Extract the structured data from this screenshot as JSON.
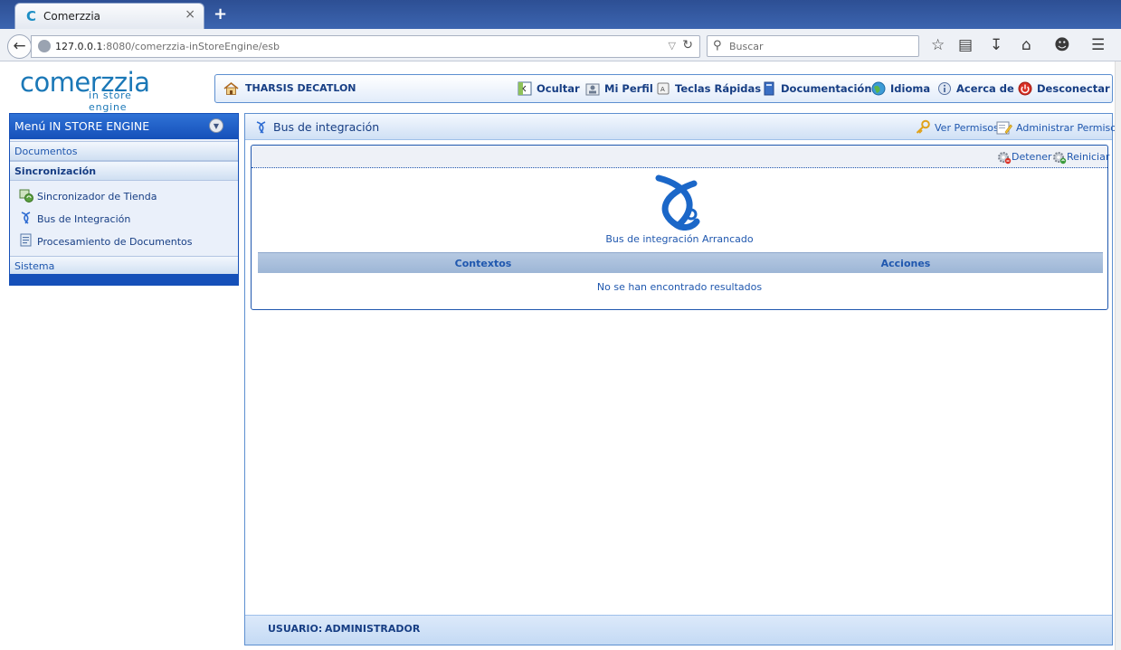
{
  "browser": {
    "tab_title": "Comerzzia",
    "tab_favicon": "C",
    "tab_close": "×",
    "new_tab": "+",
    "url_host": "127.0.0.1",
    "url_rest": ":8080/comerzzia-inStoreEngine/esb",
    "search_placeholder": "Buscar",
    "icons": [
      "back-arrow-icon",
      "globe-icon",
      "reload-icon",
      "search-icon",
      "bookmark-star-icon",
      "reading-list-icon",
      "download-icon",
      "home-icon",
      "chat-icon",
      "hamburger-menu-icon"
    ]
  },
  "logo": {
    "word": "comerzzia",
    "tagline": "in store engine"
  },
  "topbar": {
    "company": "THARSIS DECATLON",
    "menu": [
      {
        "label": "Ocultar",
        "icon": "hide-window-icon"
      },
      {
        "label": "Mi Perfil",
        "icon": "profile-icon"
      },
      {
        "label": "Teclas Rápidas",
        "icon": "keyboard-key-icon"
      },
      {
        "label": "Documentación",
        "icon": "book-icon"
      },
      {
        "label": "Idioma",
        "icon": "globe-icon"
      },
      {
        "label": "Acerca de",
        "icon": "info-icon"
      },
      {
        "label": "Desconectar",
        "icon": "power-icon"
      }
    ]
  },
  "sidebar": {
    "title": "Menú IN STORE ENGINE",
    "sections": {
      "documentos": "Documentos",
      "sincronizacion": "Sincronización",
      "sistema": "Sistema"
    },
    "items": [
      {
        "label": "Sincronizador de Tienda",
        "icon": "store-sync-icon"
      },
      {
        "label": "Bus de Integración",
        "icon": "integration-bus-icon"
      },
      {
        "label": "Procesamiento de Documentos",
        "icon": "document-processing-icon"
      }
    ]
  },
  "main": {
    "title": "Bus de integración",
    "header_links": {
      "ver_permisos": "Ver Permisos",
      "administrar_permisos": "Administrar Permisos"
    },
    "actions": {
      "detener": "Detener",
      "reiniciar": "Reiniciar"
    },
    "bus_status": "Bus de integración Arrancado",
    "columns": {
      "contextos": "Contextos",
      "acciones": "Acciones"
    },
    "empty_message": "No se han encontrado resultados",
    "footer": {
      "user_label": "USUARIO:",
      "user_value": "ADMINISTRADOR"
    }
  },
  "colors": {
    "brand_blue": "#1b78b7",
    "nav_blue": "#1550b9",
    "text_blue": "#173e84",
    "panel_border": "#5d8fd0"
  }
}
